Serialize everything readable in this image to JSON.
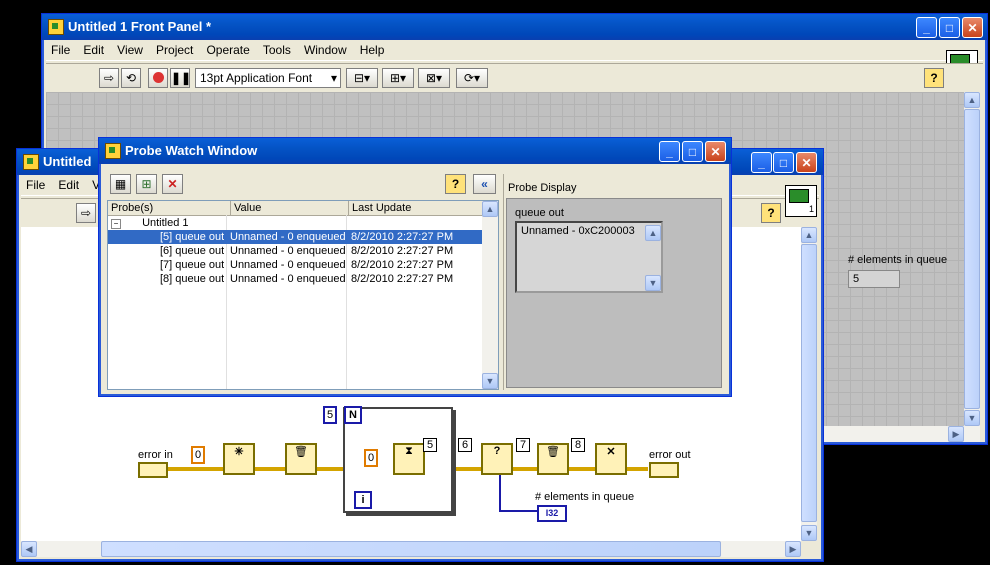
{
  "front_panel": {
    "title": "Untitled 1 Front Panel *",
    "menu": [
      "File",
      "Edit",
      "View",
      "Project",
      "Operate",
      "Tools",
      "Window",
      "Help"
    ],
    "font_select": "13pt Application Font",
    "indicator_label": "# elements in queue",
    "indicator_value": "5"
  },
  "block_diagram": {
    "title": "Untitled",
    "menu": [
      "File",
      "Edit",
      "Vie"
    ],
    "labels": {
      "error_in": "error in",
      "error_out": "error out",
      "elements_in_queue": "# elements in queue",
      "n": "N",
      "i": "i",
      "loop_count": "5",
      "zero1": "0",
      "zero2": "0",
      "probe5": "5",
      "probe6": "6",
      "probe7": "7",
      "probe8": "8",
      "i32": "I32"
    }
  },
  "probe_window": {
    "title": "Probe Watch Window",
    "columns": [
      "Probe(s)",
      "Value",
      "Last Update"
    ],
    "tree_root": "Untitled 1",
    "rows": [
      {
        "probe": "[5] queue out",
        "value": "Unnamed - 0 enqueued",
        "updated": "8/2/2010 2:27:27 PM"
      },
      {
        "probe": "[6] queue out",
        "value": "Unnamed - 0 enqueued",
        "updated": "8/2/2010 2:27:27 PM"
      },
      {
        "probe": "[7] queue out",
        "value": "Unnamed - 0 enqueued",
        "updated": "8/2/2010 2:27:27 PM"
      },
      {
        "probe": "[8] queue out",
        "value": "Unnamed - 0 enqueued",
        "updated": "8/2/2010 2:27:27 PM"
      }
    ],
    "display_header": "Probe Display",
    "display_label": "queue out",
    "display_value": "Unnamed - 0xC200003"
  }
}
